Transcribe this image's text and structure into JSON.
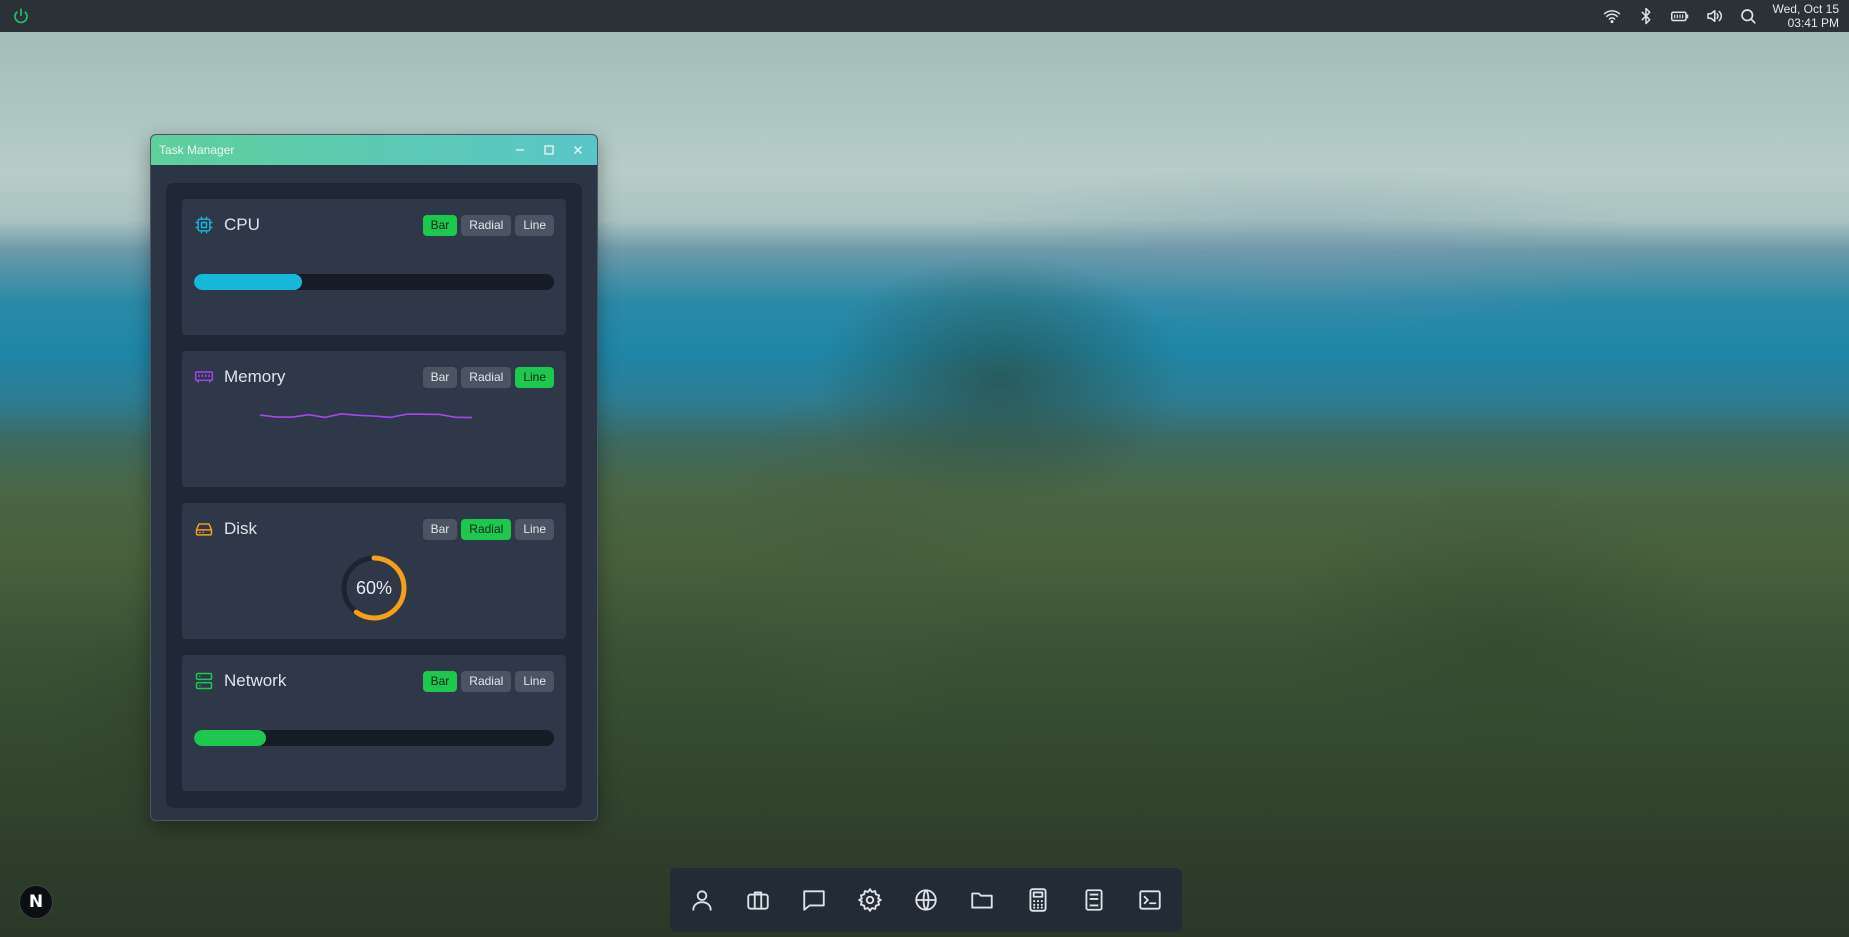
{
  "topbar": {
    "date": "Wed, Oct 15",
    "time": "03:41 PM",
    "tray_icons": [
      "wifi-icon",
      "bluetooth-icon",
      "battery-icon",
      "volume-icon",
      "search-icon"
    ]
  },
  "window": {
    "title": "Task Manager",
    "accent": "#5fcf9c"
  },
  "modes": [
    "Bar",
    "Radial",
    "Line"
  ],
  "cards": {
    "cpu": {
      "label": "CPU",
      "active_mode": "Bar",
      "percent": 30,
      "color": "#17b7dc"
    },
    "memory": {
      "label": "Memory",
      "active_mode": "Line",
      "color": "#a248f0",
      "history": [
        55,
        44,
        44,
        57,
        42,
        62,
        54,
        50,
        42,
        60,
        60,
        59,
        43,
        41
      ]
    },
    "disk": {
      "label": "Disk",
      "active_mode": "Radial",
      "percent": 60,
      "percent_text": "60%",
      "color": "#f5a016"
    },
    "network": {
      "label": "Network",
      "active_mode": "Bar",
      "percent": 20,
      "color": "#1ec84e"
    }
  },
  "dock": {
    "apps": [
      "user-icon",
      "briefcase-icon",
      "chat-icon",
      "settings-icon",
      "globe-icon",
      "folder-icon",
      "calculator-icon",
      "document-icon",
      "terminal-icon"
    ]
  },
  "launcher_letter": "N"
}
